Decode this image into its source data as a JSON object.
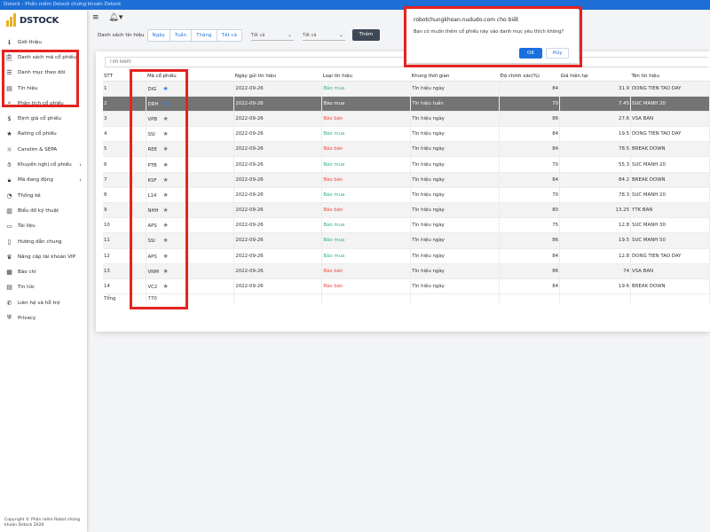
{
  "window": {
    "title": "Dstock - Phần mềm Dstock chứng khoán Dstock"
  },
  "brand": {
    "name": "DSTOCK"
  },
  "sidebar": {
    "items": [
      {
        "label": "Giới thiệu",
        "icon": "info-icon"
      },
      {
        "label": "Danh sách mã cổ phiếu",
        "icon": "clipboard-icon"
      },
      {
        "label": "Danh mục theo dõi",
        "icon": "list-icon"
      },
      {
        "label": "Tín hiệu",
        "icon": "document-icon"
      },
      {
        "label": "Phân tích cổ phiếu",
        "icon": "search-icon"
      },
      {
        "label": "Định giá cổ phiếu",
        "icon": "dollar-icon"
      },
      {
        "label": "Rating cổ phiếu",
        "icon": "star-icon"
      },
      {
        "label": "Canslim & SEPA",
        "icon": "bulb-icon"
      },
      {
        "label": "Khuyến nghị cổ phiếu",
        "icon": "handshake-icon"
      },
      {
        "label": "Mã đang động",
        "icon": "lock-icon"
      },
      {
        "label": "Thống kê",
        "icon": "chart-icon"
      },
      {
        "label": "Biểu đồ kỹ thuật",
        "icon": "bar-chart-icon"
      },
      {
        "label": "Tài liệu",
        "icon": "folder-icon"
      },
      {
        "label": "Hướng dẫn chung",
        "icon": "book-icon"
      },
      {
        "label": "Nâng cấp tài khoản VIP",
        "icon": "crown-icon"
      },
      {
        "label": "Báo chí",
        "icon": "newspaper-icon"
      },
      {
        "label": "Tin tức",
        "icon": "news-icon"
      },
      {
        "label": "Liên hệ và hỗ trợ",
        "icon": "phone-icon"
      },
      {
        "label": "Privacy",
        "icon": "shield-icon"
      }
    ],
    "copyright": "Copyright © Phần mềm Robot chứng khoán Dstock 2020"
  },
  "filters": {
    "label": "Danh sách tín hiệu",
    "periods": [
      "Ngày",
      "Tuần",
      "Tháng",
      "Tất cả"
    ],
    "select1": "Tất cả",
    "select2": "Tất cả",
    "add_button": "Thêm"
  },
  "search": {
    "placeholder": "Tìm kiếm"
  },
  "table": {
    "headers": [
      "STT",
      "Mã cổ phiếu",
      "Ngày gửi tín hiệu",
      "Loại tín hiệu",
      "Khung thời gian",
      "Độ chính xác(%)",
      "Giá hiện tại",
      "Tên tín hiệu"
    ],
    "rows": [
      {
        "stt": "1",
        "code": "DIG",
        "date": "2022-09-26",
        "type": "Báo mua",
        "frame": "Tín hiệu ngày",
        "acc": "84",
        "price": "31.9",
        "name": "DONG TIEN TAO DAY"
      },
      {
        "stt": "2",
        "code": "DRH",
        "date": "2022-09-26",
        "type": "Báo mua",
        "frame": "Tín hiệu tuần",
        "acc": "70",
        "price": "7.45",
        "name": "SUC MANH 20"
      },
      {
        "stt": "3",
        "code": "VPB",
        "date": "2022-09-26",
        "type": "Báo bán",
        "frame": "Tín hiệu ngày",
        "acc": "86",
        "price": "27.6",
        "name": "VSA BAN"
      },
      {
        "stt": "4",
        "code": "SSI",
        "date": "2022-09-26",
        "type": "Báo mua",
        "frame": "Tín hiệu ngày",
        "acc": "84",
        "price": "19.5",
        "name": "DONG TIEN TAO DAY"
      },
      {
        "stt": "5",
        "code": "REE",
        "date": "2022-09-26",
        "type": "Báo bán",
        "frame": "Tín hiệu ngày",
        "acc": "84",
        "price": "78.5",
        "name": "BREAK DOWN"
      },
      {
        "stt": "6",
        "code": "PTB",
        "date": "2022-09-26",
        "type": "Báo mua",
        "frame": "Tín hiệu ngày",
        "acc": "70",
        "price": "55.3",
        "name": "SUC MANH 20"
      },
      {
        "stt": "7",
        "code": "KSF",
        "date": "2022-09-26",
        "type": "Báo bán",
        "frame": "Tín hiệu ngày",
        "acc": "84",
        "price": "84.2",
        "name": "BREAK DOWN"
      },
      {
        "stt": "8",
        "code": "L14",
        "date": "2022-09-26",
        "type": "Báo mua",
        "frame": "Tín hiệu ngày",
        "acc": "70",
        "price": "78.3",
        "name": "SUC MANH 20"
      },
      {
        "stt": "9",
        "code": "NHH",
        "date": "2022-09-26",
        "type": "Báo bán",
        "frame": "Tín hiệu ngày",
        "acc": "80",
        "price": "13.25",
        "name": "YTK BAN"
      },
      {
        "stt": "10",
        "code": "APS",
        "date": "2022-09-26",
        "type": "Báo mua",
        "frame": "Tín hiệu ngày",
        "acc": "75",
        "price": "12.8",
        "name": "SUC MANH 30"
      },
      {
        "stt": "11",
        "code": "SSI",
        "date": "2022-09-26",
        "type": "Báo mua",
        "frame": "Tín hiệu ngày",
        "acc": "86",
        "price": "19.5",
        "name": "SUC MANH 50"
      },
      {
        "stt": "12",
        "code": "APS",
        "date": "2022-09-26",
        "type": "Báo mua",
        "frame": "Tín hiệu ngày",
        "acc": "84",
        "price": "12.8",
        "name": "DONG TIEN TAO DAY"
      },
      {
        "stt": "13",
        "code": "VNM",
        "date": "2022-09-26",
        "type": "Báo bán",
        "frame": "Tín hiệu ngày",
        "acc": "86",
        "price": "74",
        "name": "VSA BAN"
      },
      {
        "stt": "14",
        "code": "VC2",
        "date": "2022-09-26",
        "type": "Báo bán",
        "frame": "Tín hiệu ngày",
        "acc": "84",
        "price": "19.6",
        "name": "BREAK DOWN"
      }
    ],
    "total_label": "Tổng",
    "total_value": "770"
  },
  "dialog": {
    "title": "robotchungkhoan.nududo.com cho biết",
    "message": "Bạn có muốn thêm cổ phiếu này vào danh mục yêu thích không?",
    "ok": "OK",
    "cancel": "Hủy"
  },
  "colors": {
    "accent": "#1a6fdc",
    "buy": "#38b27a",
    "sell": "#e44c4c",
    "highlight": "#e52320",
    "brand_gold": "#e6b123"
  }
}
